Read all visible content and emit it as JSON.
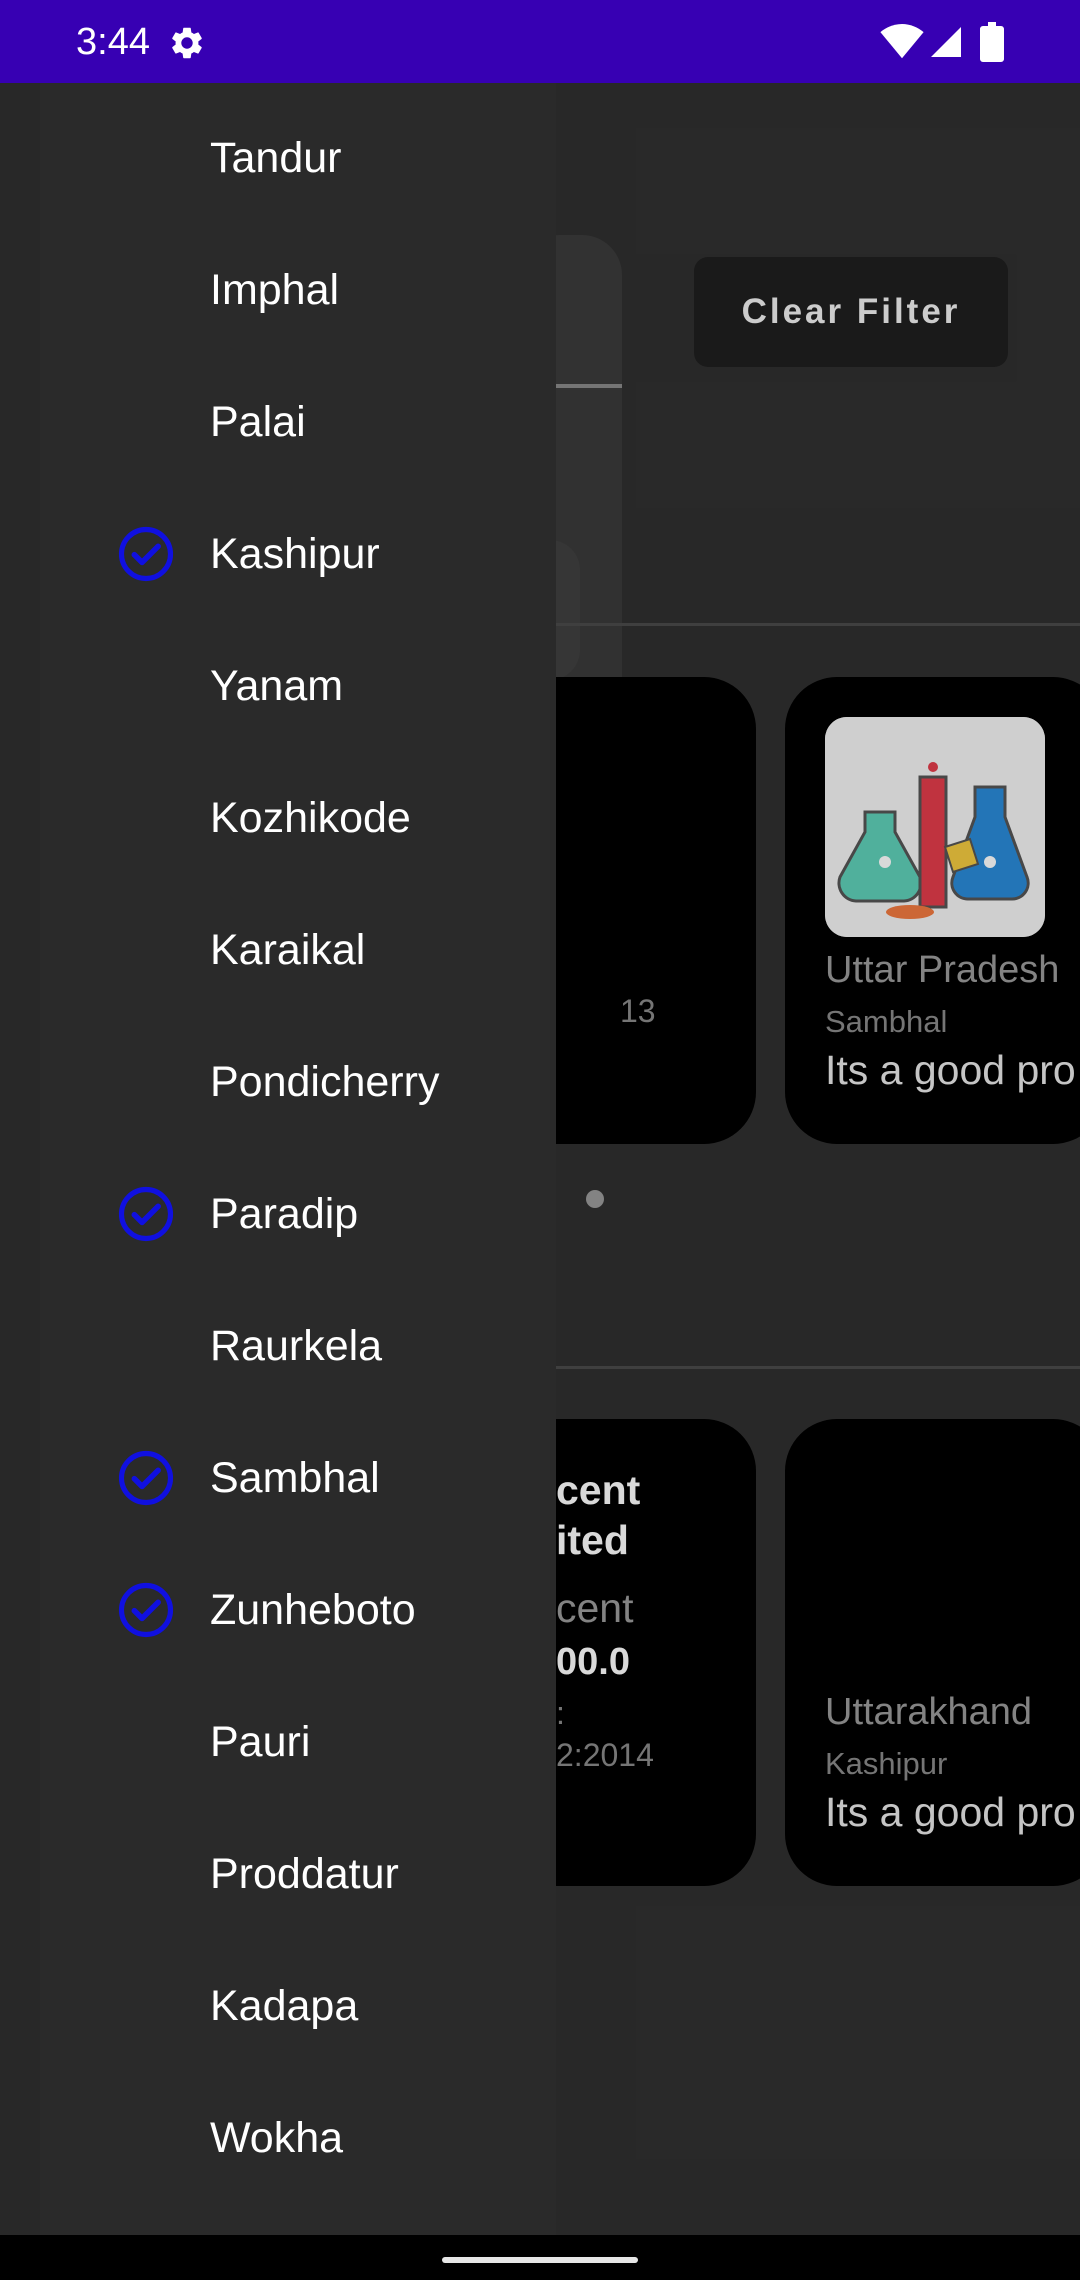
{
  "status_bar": {
    "time": "3:44",
    "color": "#3700b3"
  },
  "toolbar": {
    "clear_filter_label": "Clear Filter"
  },
  "cards_row1": [
    {
      "partial_text": "13"
    },
    {
      "state": "Uttar Pradesh",
      "city": "Sambhal",
      "description": "Its a good pro"
    }
  ],
  "cards_row2": [
    {
      "line1": "cent",
      "line2": "ited",
      "line3": "cent",
      "line4": "00.0",
      "line5": ":",
      "line6": "2:2014"
    },
    {
      "state": "Uttarakhand",
      "city": "Kashipur",
      "description": "Its a good pro"
    }
  ],
  "drawer": {
    "items": [
      {
        "label": "Tandur",
        "checked": false
      },
      {
        "label": "Imphal",
        "checked": false
      },
      {
        "label": "Palai",
        "checked": false
      },
      {
        "label": "Kashipur",
        "checked": true
      },
      {
        "label": "Yanam",
        "checked": false
      },
      {
        "label": "Kozhikode",
        "checked": false
      },
      {
        "label": "Karaikal",
        "checked": false
      },
      {
        "label": "Pondicherry",
        "checked": false
      },
      {
        "label": "Paradip",
        "checked": true
      },
      {
        "label": "Raurkela",
        "checked": false
      },
      {
        "label": "Sambhal",
        "checked": true
      },
      {
        "label": "Zunheboto",
        "checked": true
      },
      {
        "label": "Pauri",
        "checked": false
      },
      {
        "label": "Proddatur",
        "checked": false
      },
      {
        "label": "Kadapa",
        "checked": false
      },
      {
        "label": "Wokha",
        "checked": false
      }
    ],
    "check_color": "#1010e0"
  },
  "icons": {
    "status_settings": "gear-icon",
    "status_wifi": "wifi-icon",
    "status_signal": "signal-icon",
    "status_battery": "battery-icon",
    "drawer_check": "check-circle-icon"
  }
}
